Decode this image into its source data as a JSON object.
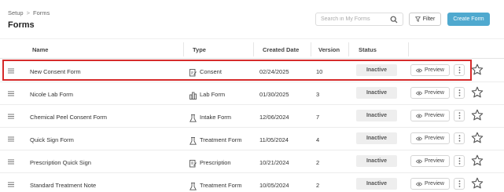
{
  "breadcrumb": {
    "parent": "Setup",
    "separator": ">",
    "current": "Forms"
  },
  "page": {
    "title": "Forms"
  },
  "search": {
    "placeholder": "Search in My Forms"
  },
  "toolbar": {
    "filter_label": "Filter",
    "create_label": "Create Form"
  },
  "columns": {
    "name": "Name",
    "type": "Type",
    "created": "Created Date",
    "version": "Version",
    "status": "Status"
  },
  "rows": [
    {
      "name": "New Consent Form",
      "type": "Consent",
      "type_icon": "consent-icon",
      "created": "02/24/2025",
      "version": "10",
      "status": "Inactive",
      "preview": "Preview"
    },
    {
      "name": "Nicole Lab Form",
      "type": "Lab Form",
      "type_icon": "lab-form-icon",
      "created": "01/30/2025",
      "version": "3",
      "status": "Inactive",
      "preview": "Preview"
    },
    {
      "name": "Chemical Peel Consent Form",
      "type": "Intake Form",
      "type_icon": "intake-form-icon",
      "created": "12/06/2024",
      "version": "7",
      "status": "Inactive",
      "preview": "Preview"
    },
    {
      "name": "Quick Sign Form",
      "type": "Treatment Form",
      "type_icon": "treatment-form-icon",
      "created": "11/05/2024",
      "version": "4",
      "status": "Inactive",
      "preview": "Preview"
    },
    {
      "name": "Prescription Quick Sign",
      "type": "Prescription",
      "type_icon": "prescription-icon",
      "created": "10/21/2024",
      "version": "2",
      "status": "Inactive",
      "preview": "Preview"
    },
    {
      "name": "Standard Treatment Note",
      "type": "Treatment Form",
      "type_icon": "treatment-form-icon",
      "created": "10/05/2024",
      "version": "2",
      "status": "Inactive",
      "preview": "Preview"
    }
  ],
  "colors": {
    "accent": "#4fa9cf",
    "highlight": "#d62b2b",
    "status_bg": "#eeeeee"
  }
}
